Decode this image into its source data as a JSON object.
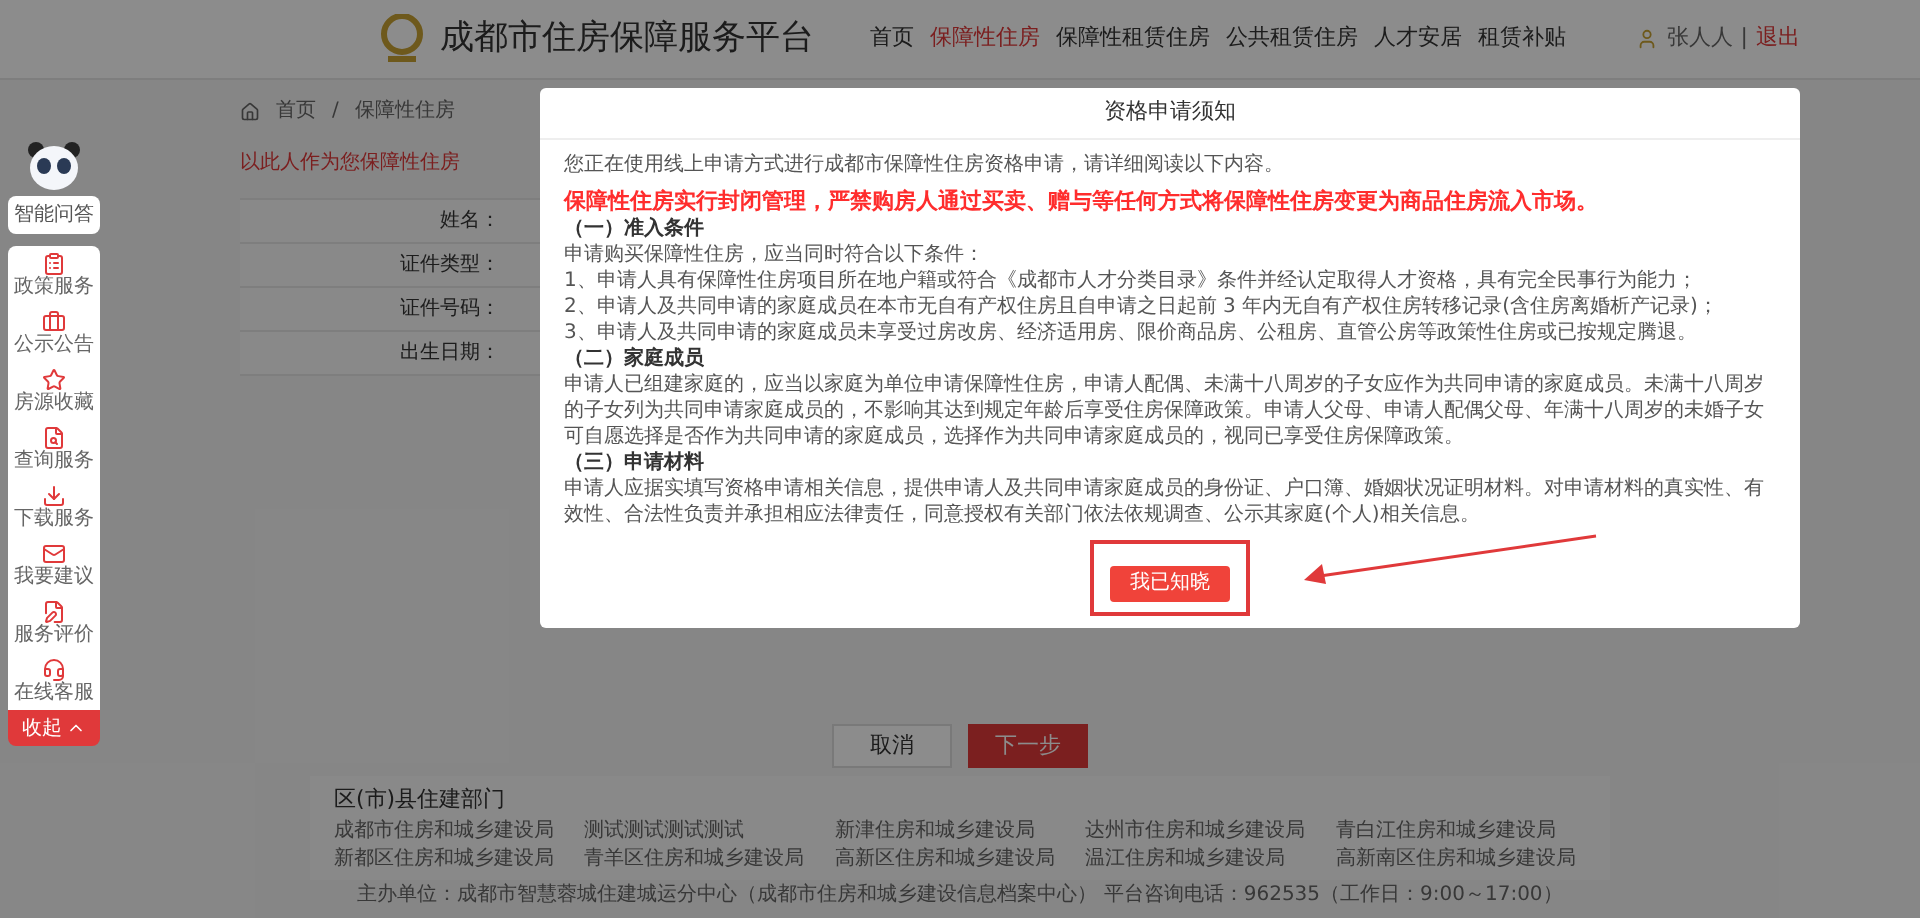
{
  "header": {
    "site_title": "成都市住房保障服务平台",
    "nav": [
      {
        "label": "首页",
        "selected": false
      },
      {
        "label": "保障性住房",
        "selected": true
      },
      {
        "label": "保障性租赁住房",
        "selected": false
      },
      {
        "label": "公共租赁住房",
        "selected": false
      },
      {
        "label": "人才安居",
        "selected": false
      },
      {
        "label": "租赁补贴",
        "selected": false
      }
    ],
    "user": "张人人",
    "separator": "|",
    "logout": "退出"
  },
  "breadcrumb": {
    "items": [
      "首页",
      "保障性住房"
    ],
    "separator": "/"
  },
  "notice": "以此人作为您保障性住房",
  "form": {
    "fields": [
      "姓名：",
      "证件类型：",
      "证件号码：",
      "出生日期："
    ]
  },
  "actions": {
    "cancel": "取消",
    "next": "下一步"
  },
  "departments": {
    "title": "区(市)县住建部门",
    "links": [
      "成都市住房和城乡建设局",
      "测试测试测试测试",
      "新津住房和城乡建设局",
      "达州市住房和城乡建设局",
      "青白江住房和城乡建设局",
      "新都区住房和城乡建设局",
      "青羊区住房和城乡建设局",
      "高新区住房和城乡建设局",
      "温江住房和城乡建设局",
      "高新南区住房和城乡建设局"
    ]
  },
  "footer": "主办单位：成都市智慧蓉城住建城运分中心（成都市住房和城乡建设信息档案中心） 平台咨询电话：962535（工作日：9:00～17:00）",
  "sidebar": {
    "assistant": "智能问答",
    "items": [
      "政策服务",
      "公示公告",
      "房源收藏",
      "查询服务",
      "下载服务",
      "我要建议",
      "服务评价",
      "在线客服"
    ],
    "collapse": "收起"
  },
  "dialog": {
    "title": "资格申请须知",
    "intro": "您正在使用线上申请方式进行成都市保障性住房资格申请，请详细阅读以下内容。",
    "warning": "保障性住房实行封闭管理，严禁购房人通过买卖、赠与等任何方式将保障性住房变更为商品住房流入市场。",
    "sections": [
      {
        "heading": "（一）准入条件",
        "paragraphs": [
          "申请购买保障性住房，应当同时符合以下条件：",
          "1、申请人具有保障性住房项目所在地户籍或符合《成都市人才分类目录》条件并经认定取得人才资格，具有完全民事行为能力；",
          "2、申请人及共同申请的家庭成员在本市无自有产权住房且自申请之日起前 3 年内无自有产权住房转移记录(含住房离婚析产记录)；",
          "3、申请人及共同申请的家庭成员未享受过房改房、经济适用房、限价商品房、公租房、直管公房等政策性住房或已按规定腾退。"
        ]
      },
      {
        "heading": "（二）家庭成员",
        "paragraphs": [
          "申请人已组建家庭的，应当以家庭为单位申请保障性住房，申请人配偶、未满十八周岁的子女应作为共同申请的家庭成员。未满十八周岁的子女列为共同申请家庭成员的，不影响其达到规定年龄后享受住房保障政策。申请人父母、申请人配偶父母、年满十八周岁的未婚子女可自愿选择是否作为共同申请的家庭成员，选择作为共同申请家庭成员的，视同已享受住房保障政策。"
        ]
      },
      {
        "heading": "（三）申请材料",
        "paragraphs": [
          "申请人应据实填写资格申请相关信息，提供申请人及共同申请家庭成员的身份证、户口簿、婚姻状况证明材料。对申请材料的真实性、有效性、合法性负责并承担相应法律责任，同意授权有关部门依法依规调查、公示其家庭(个人)相关信息。"
        ]
      }
    ],
    "confirm": "我已知晓"
  }
}
